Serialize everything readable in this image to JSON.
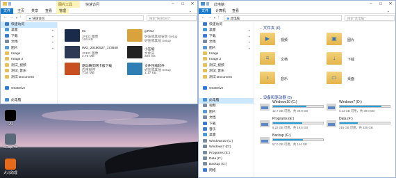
{
  "desktop": {
    "icons": [
      {
        "label": "QQ",
        "icon": "penguin-icon",
        "color": "#000"
      },
      {
        "label": "SCapPro",
        "icon": "camera-icon",
        "color": "#5a6a7a"
      },
      {
        "label": "犬北助理",
        "icon": "app-icon",
        "color": "#e66a1a"
      }
    ]
  },
  "left_window": {
    "title": "快速访问",
    "context_tab": "图片工具",
    "tabs": [
      "文件",
      "主页",
      "共享",
      "查看",
      "管理"
    ],
    "address": "快速访问",
    "search_placeholder": "搜索\"快速访问\"",
    "sidebar": [
      {
        "label": "快速访问",
        "icon": "star-icon",
        "color": "#3a78c4",
        "pinned": false,
        "selected": true
      },
      {
        "label": "桌面",
        "icon": "desktop-icon",
        "color": "#4a9ad8",
        "pinned": true
      },
      {
        "label": "下载",
        "icon": "download-icon",
        "color": "#3c7bd0",
        "pinned": true
      },
      {
        "label": "文档",
        "icon": "document-icon",
        "color": "#7a8ba0",
        "pinned": true
      },
      {
        "label": "图片",
        "icon": "picture-icon",
        "color": "#5b9bd5",
        "pinned": true
      },
      {
        "label": "Image",
        "icon": "folder-icon",
        "color": "#e8c05a",
        "pinned": false
      },
      {
        "label": "Image 2",
        "icon": "folder-icon",
        "color": "#e8c05a",
        "pinned": false
      },
      {
        "label": "测试_视频",
        "icon": "folder-icon",
        "color": "#e8c05a",
        "pinned": false
      },
      {
        "label": "测试_音乐",
        "icon": "folder-icon",
        "color": "#e8c05a",
        "pinned": false
      },
      {
        "label": "测试 Document",
        "icon": "folder-icon",
        "color": "#e8c05a",
        "pinned": false
      },
      {
        "label": "",
        "icon": "spacer",
        "color": "#fff",
        "pinned": false
      },
      {
        "label": "OneDrive",
        "icon": "cloud-icon",
        "color": "#2a7ad8",
        "pinned": false
      },
      {
        "label": "",
        "icon": "spacer",
        "color": "#fff",
        "pinned": false
      },
      {
        "label": "此电脑",
        "icon": "computer-icon",
        "color": "#4a90d9",
        "pinned": false
      }
    ],
    "files": [
      {
        "name": "01",
        "type": "JPEG 图像",
        "size": "106 KB",
        "color": "#1a2a4a"
      },
      {
        "name": "g.Rrar",
        "type": "好压或其他安装 Setup",
        "size": "好压或其他 Setup",
        "color": "#d9a23b"
      },
      {
        "name": "IMG_20150527_173848",
        "type": "JPEG 图像",
        "size": "2.76 MB",
        "color": "#2e3a55"
      },
      {
        "name": "小压缩",
        "type": "文件夹",
        "size": "329 KB",
        "color": "#222"
      },
      {
        "name": "驱动精灵网卡版下载",
        "type": "应用程序",
        "size": "7.04 MB",
        "color": "#c85020"
      },
      {
        "name": "文件压缩软件",
        "type": "好压或其他 Setup",
        "size": "1.17 KB",
        "color": "#2f7fb5"
      }
    ]
  },
  "right_window": {
    "title": "此电脑",
    "tabs": [
      "文件",
      "计算机",
      "查看"
    ],
    "address": "此电脑",
    "search_placeholder": "搜索\"此电脑\"",
    "sidebar": [
      {
        "label": "快速访问",
        "icon": "star-icon",
        "color": "#3a78c4",
        "pinned": false
      },
      {
        "label": "桌面",
        "icon": "desktop-icon",
        "color": "#4a9ad8",
        "pinned": true
      },
      {
        "label": "下载",
        "icon": "download-icon",
        "color": "#3c7bd0",
        "pinned": true
      },
      {
        "label": "文档",
        "icon": "document-icon",
        "color": "#7a8ba0",
        "pinned": true
      },
      {
        "label": "图片",
        "icon": "picture-icon",
        "color": "#5b9bd5",
        "pinned": true
      },
      {
        "label": "Image",
        "icon": "folder-icon",
        "color": "#e8c05a",
        "pinned": false
      },
      {
        "label": "Image 2",
        "icon": "folder-icon",
        "color": "#e8c05a",
        "pinned": false
      },
      {
        "label": "测试_视频",
        "icon": "folder-icon",
        "color": "#e8c05a",
        "pinned": false
      },
      {
        "label": "测试_音乐",
        "icon": "folder-icon",
        "color": "#e8c05a",
        "pinned": false
      },
      {
        "label": "测试 Document",
        "icon": "folder-icon",
        "color": "#e8c05a",
        "pinned": false
      },
      {
        "label": "",
        "icon": "spacer",
        "color": "#fff",
        "pinned": false
      },
      {
        "label": "OneDrive",
        "icon": "cloud-icon",
        "color": "#2a7ad8",
        "pinned": false
      },
      {
        "label": "",
        "icon": "spacer",
        "color": "#fff",
        "pinned": false
      },
      {
        "label": "此电脑",
        "icon": "computer-icon",
        "color": "#4a90d9",
        "pinned": false,
        "selected": true
      },
      {
        "label": "视频",
        "icon": "video-icon",
        "color": "#7a8ba0",
        "pinned": false
      },
      {
        "label": "图片",
        "icon": "picture-icon",
        "color": "#5b9bd5",
        "pinned": false
      },
      {
        "label": "文档",
        "icon": "document-icon",
        "color": "#7a8ba0",
        "pinned": false
      },
      {
        "label": "下载",
        "icon": "download-icon",
        "color": "#3c7bd0",
        "pinned": false
      },
      {
        "label": "音乐",
        "icon": "music-icon",
        "color": "#3c7bd0",
        "pinned": false
      },
      {
        "label": "桌面",
        "icon": "desktop-icon",
        "color": "#4a9ad8",
        "pinned": false
      },
      {
        "label": "Windows10 (C:)",
        "icon": "drive-icon",
        "color": "#7a8ba0",
        "pinned": false
      },
      {
        "label": "Windows7 (D:)",
        "icon": "drive-icon",
        "color": "#7a8ba0",
        "pinned": false
      },
      {
        "label": "Programs (E:)",
        "icon": "drive-icon",
        "color": "#7a8ba0",
        "pinned": false
      },
      {
        "label": "Data (F:)",
        "icon": "drive-icon",
        "color": "#7a8ba0",
        "pinned": false
      },
      {
        "label": "Backup (G:)",
        "icon": "drive-icon",
        "color": "#7a8ba0",
        "pinned": false
      },
      {
        "label": "网络",
        "icon": "network-icon",
        "color": "#3c7bd0",
        "pinned": false
      }
    ],
    "folders_header": "文件夹 (6)",
    "folders": [
      {
        "label": "视频",
        "icon": "video-folder-icon"
      },
      {
        "label": "图片",
        "icon": "picture-folder-icon"
      },
      {
        "label": "文档",
        "icon": "document-folder-icon"
      },
      {
        "label": "下载",
        "icon": "download-folder-icon"
      },
      {
        "label": "音乐",
        "icon": "music-folder-icon"
      },
      {
        "label": "桌面",
        "icon": "desktop-folder-icon"
      }
    ],
    "drives_header": "设备和驱动器 (5)",
    "drives": [
      {
        "name": "Windows10 (C:)",
        "space": "12.7 GB 可用，共 39.0 GB",
        "used": 0.67
      },
      {
        "name": "Windows7 (D:)",
        "space": "6.13 GB 可用，共 39.0 GB",
        "used": 0.84
      },
      {
        "name": "Programs (E:)",
        "space": "8.22 GB 可用，共 19.5 GB",
        "used": 0.58
      },
      {
        "name": "Data (F:)",
        "space": "215 GB 可用，共 335 GB",
        "used": 0.36
      },
      {
        "name": "Backup (G:)",
        "space": "57.0 GB 可用，共 144 GB",
        "used": 0.6
      }
    ]
  },
  "colors": {
    "file_tab": "#1979ca",
    "context_tab": "#fff3b8",
    "selected": "#cce8ff",
    "drive_fill": "#26a0da",
    "group_header": "#1e3d8f"
  }
}
